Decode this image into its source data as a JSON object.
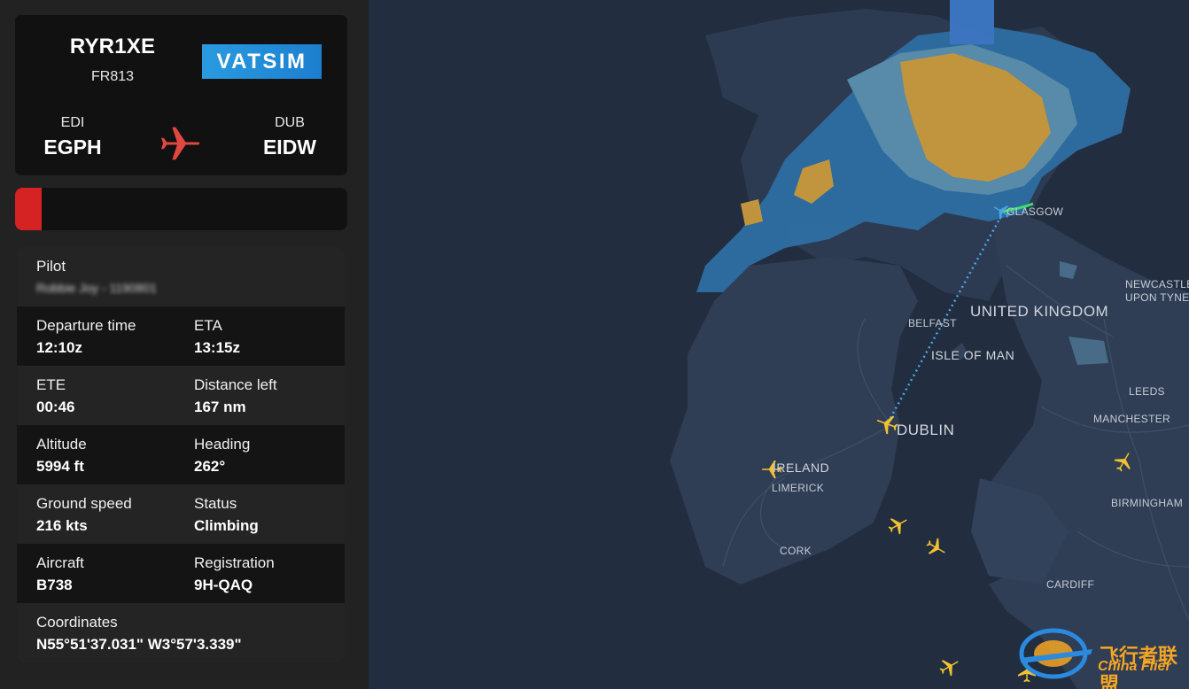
{
  "flight": {
    "callsign": "RYR1XE",
    "flight_number": "FR813",
    "network": "VATSIM",
    "origin": {
      "iata": "EDI",
      "icao": "EGPH"
    },
    "destination": {
      "iata": "DUB",
      "icao": "EIDW"
    }
  },
  "progress": {
    "percent": 8,
    "color": "#d52222"
  },
  "details": {
    "pilot": {
      "label": "Pilot",
      "value": "Robbie Joy - 1190801"
    },
    "departure_time": {
      "label": "Departure time",
      "value": "12:10z"
    },
    "eta": {
      "label": "ETA",
      "value": "13:15z"
    },
    "ete": {
      "label": "ETE",
      "value": "00:46"
    },
    "distance_left": {
      "label": "Distance left",
      "value": "167 nm"
    },
    "altitude": {
      "label": "Altitude",
      "value": "5994 ft"
    },
    "heading": {
      "label": "Heading",
      "value": "262°"
    },
    "ground_speed": {
      "label": "Ground speed",
      "value": "216 kts"
    },
    "status": {
      "label": "Status",
      "value": "Climbing"
    },
    "aircraft": {
      "label": "Aircraft",
      "value": "B738"
    },
    "registration": {
      "label": "Registration",
      "value": "9H-QAQ"
    },
    "coordinates": {
      "label": "Coordinates",
      "value": "N55°51'37.031\" W3°57'3.339\""
    }
  },
  "map": {
    "labels": {
      "glasgow": "GLASGOW",
      "newcastle1": "NEWCASTLE",
      "newcastle2": "UPON TYNE",
      "united_kingdom": "UNITED KINGDOM",
      "belfast": "BELFAST",
      "isle_of_man": "ISLE OF MAN",
      "leeds": "LEEDS",
      "manchester": "MANCHESTER",
      "dublin": "DUBLIN",
      "ireland": "IRELAND",
      "limerick": "LIMERICK",
      "birmingham": "BIRMINGHAM",
      "cork": "CORK",
      "cardiff": "CARDIFF"
    },
    "colors": {
      "sea": "#222d3f",
      "land": "#2c3a50",
      "radar_light": "#2f6fa6",
      "radar_mid": "#5a8fae",
      "radar_heavy": "#c8993a",
      "aircraft": "#f2c230",
      "route": "#4aa6e8"
    }
  },
  "watermark": {
    "cn": "飞行者联盟",
    "en": "China Flier"
  }
}
